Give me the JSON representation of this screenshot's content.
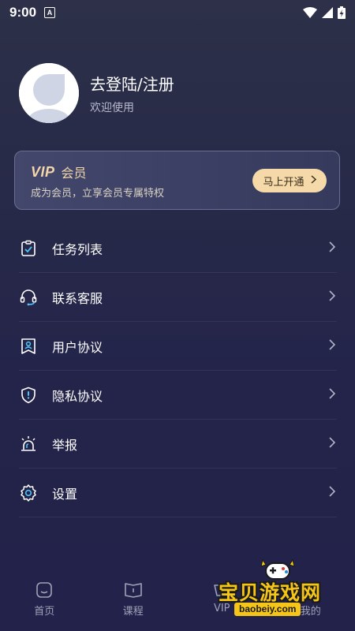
{
  "status_bar": {
    "time": "9:00",
    "notification_badge": "A"
  },
  "profile": {
    "login_text": "去登陆/注册",
    "welcome_text": "欢迎使用"
  },
  "vip": {
    "logo": "VIP",
    "title": "会员",
    "description": "成为会员，立享会员专属特权",
    "button_label": "马上开通",
    "accent_color": "#f3d7ab"
  },
  "menu": [
    {
      "label": "任务列表",
      "icon": "task-list-icon"
    },
    {
      "label": "联系客服",
      "icon": "headset-icon"
    },
    {
      "label": "用户协议",
      "icon": "user-agreement-icon"
    },
    {
      "label": "隐私协议",
      "icon": "privacy-shield-icon"
    },
    {
      "label": "举报",
      "icon": "alarm-siren-icon"
    },
    {
      "label": "设置",
      "icon": "gear-icon"
    }
  ],
  "bottom_nav": [
    {
      "label": "首页",
      "icon": "home-icon"
    },
    {
      "label": "课程",
      "icon": "book-icon"
    },
    {
      "label": "VIP",
      "icon": "vip-icon"
    },
    {
      "label": "我的",
      "icon": "profile-icon"
    }
  ],
  "watermark": {
    "text": "宝贝游戏网",
    "url": "baobeiy.com"
  }
}
